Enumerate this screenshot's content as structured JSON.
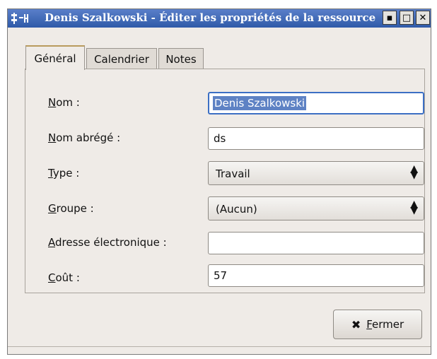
{
  "window": {
    "title": "Denis Szalkowski - Éditer les propriétés de la ressource",
    "controls": {
      "minimize": "▪",
      "maximize": "□",
      "close": "✕"
    }
  },
  "tabs": [
    {
      "label": "Général",
      "active": true
    },
    {
      "label": "Calendrier",
      "active": false
    },
    {
      "label": "Notes",
      "active": false
    }
  ],
  "form": {
    "nom": {
      "mnemonic": "N",
      "rest": "om :",
      "value": "Denis Szalkowski"
    },
    "nom_abrege": {
      "mnemonic": "N",
      "rest": "om abrégé :",
      "value": "ds"
    },
    "type": {
      "mnemonic": "T",
      "rest": "ype :",
      "value": "Travail"
    },
    "groupe": {
      "mnemonic": "G",
      "rest": "roupe :",
      "value": "(Aucun)"
    },
    "adresse": {
      "mnemonic": "A",
      "rest": "dresse électronique :",
      "value": ""
    },
    "cout": {
      "mnemonic": "C",
      "rest": "oût :",
      "value": "57"
    }
  },
  "buttons": {
    "close": {
      "icon": "✖",
      "mnemonic": "F",
      "rest": "ermer"
    }
  },
  "colors": {
    "titlebar": "#3e66b5",
    "selection": "#5e82c4",
    "focus_border": "#3c6fc4"
  }
}
